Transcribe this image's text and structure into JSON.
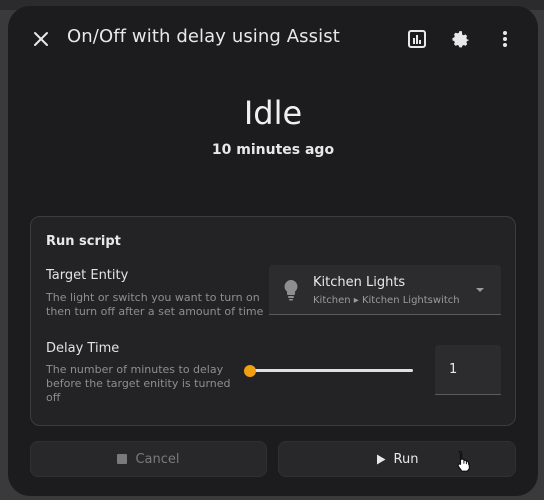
{
  "dialog": {
    "title": "On/Off with delay using Assist",
    "state": "Idle",
    "last_changed": "10 minutes ago"
  },
  "icons": {
    "close": "close-icon",
    "history": "chart-bar-icon",
    "settings": "gear-icon",
    "menu": "more-vertical-icon",
    "bulb": "lightbulb-icon",
    "dropdown": "caret-down-icon",
    "stop": "stop-square-icon",
    "play": "play-triangle-icon"
  },
  "card": {
    "title": "Run script",
    "target": {
      "label": "Target Entity",
      "description_line1": "The light or switch you want to turn on",
      "description_line2": "then turn off after a set amount of time",
      "entity_name": "Kitchen Lights",
      "entity_path": "Kitchen ▸ Kitchen Lightswitch"
    },
    "delay": {
      "label": "Delay Time",
      "description_line1": "The number of minutes to delay",
      "description_line2": "before the target enitity is turned",
      "description_line3": "off",
      "value": "1",
      "slider_fraction": 0
    }
  },
  "buttons": {
    "cancel": "Cancel",
    "run": "Run"
  },
  "colors": {
    "accent": "#f0a010",
    "surface": "#1c1c1e",
    "card": "#232325"
  }
}
